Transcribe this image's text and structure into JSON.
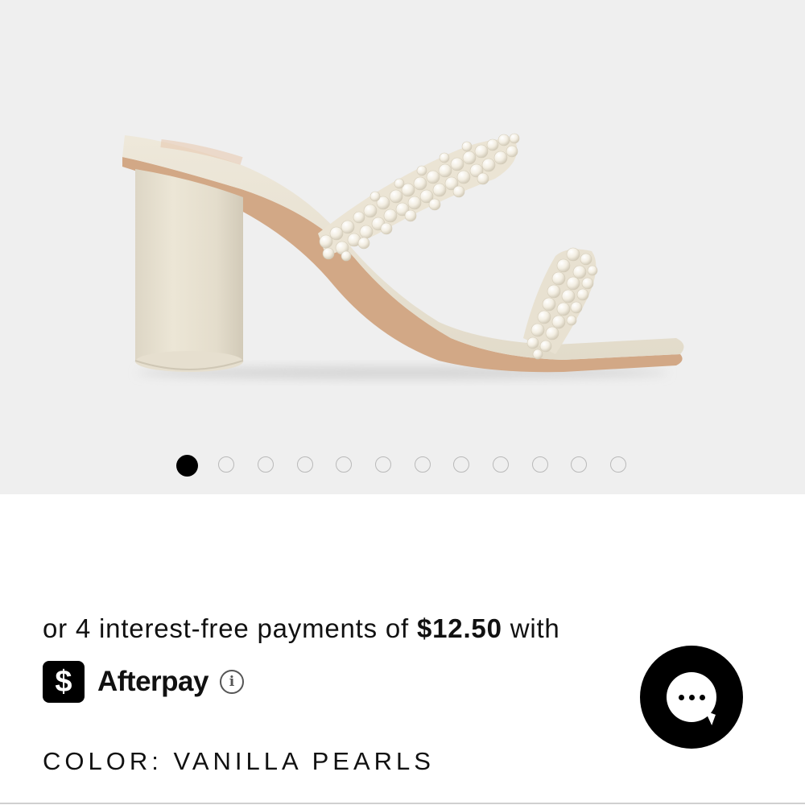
{
  "gallery": {
    "image_icon": "pearl-strap-block-heel-sandal",
    "slide_count": 12,
    "active_slide": 1
  },
  "payment": {
    "prefix": "or 4 interest-free payments of",
    "amount": "$12.50",
    "suffix": "with",
    "provider_logo_glyph": "$",
    "provider": "Afterpay",
    "info_icon": "info-icon",
    "info_glyph": "i"
  },
  "color": {
    "label": "COLOR:",
    "value": "VANILLA PEARLS"
  },
  "chat": {
    "icon": "chat-bubble-icon"
  },
  "colors": {
    "gallery_bg": "#efefef",
    "text": "#111111",
    "accent": "#000000",
    "dot_border": "#b9b9b9"
  }
}
